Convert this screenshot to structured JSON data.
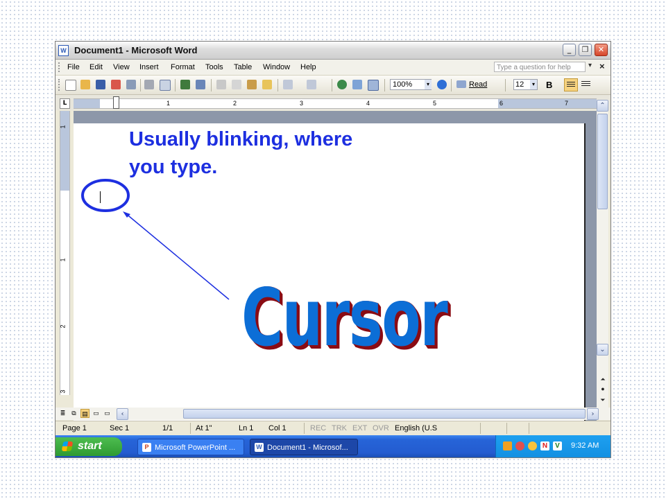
{
  "window": {
    "title": "Document1 - Microsoft Word",
    "doc_icon": "W",
    "minimize_icon": "_",
    "restore_icon": "❐",
    "close_icon": "✕"
  },
  "menu": {
    "items": [
      "File",
      "Edit",
      "View",
      "Insert",
      "Format",
      "Tools",
      "Table",
      "Window",
      "Help"
    ],
    "help_placeholder": "Type a question for help",
    "close_icon": "×",
    "dropdown_icon": "▾"
  },
  "toolbar": {
    "zoom": "100%",
    "read_label": "Read",
    "font_size": "12",
    "bold_label": "B",
    "dropdown_icon": "▾",
    "icons": [
      "new-icon",
      "open-icon",
      "save-icon",
      "permission-icon",
      "print-icon",
      "print-preview-icon",
      "spelling-icon",
      "research-icon",
      "cut-icon",
      "copy-icon",
      "paste-icon",
      "format-painter-icon",
      "undo-icon",
      "redo-icon",
      "hyperlink-icon",
      "tables-borders-icon",
      "insert-table-icon"
    ]
  },
  "ruler": {
    "tab_selector": "L",
    "horizontal_numbers": [
      "1",
      "2",
      "3",
      "4",
      "5",
      "6",
      "7"
    ],
    "vertical_numbers": [
      "1",
      "1",
      "2",
      "3"
    ]
  },
  "scrollbar": {
    "up_icon": "⌃",
    "down_icon": "⌄",
    "prev_page_icon": "⏶",
    "select_browse_icon": "●",
    "next_page_icon": "⏷",
    "left_icon": "‹",
    "right_icon": "›",
    "thumb_grip": "≡",
    "h_thumb_grip": "|||"
  },
  "view_buttons": [
    "≣",
    "⧉",
    "▤",
    "▭"
  ],
  "status": {
    "page": "Page  1",
    "section": "Sec  1",
    "page_of": "1/1",
    "at": "At  1\"",
    "line": "Ln  1",
    "col": "Col  1",
    "rec": "REC",
    "trk": "TRK",
    "ext": "EXT",
    "ovr": "OVR",
    "language": "English (U.S"
  },
  "taskbar": {
    "start": "start",
    "items": [
      {
        "label": "Microsoft PowerPoint ...",
        "icon": "P"
      },
      {
        "label": "Document1 - Microsof...",
        "icon": "W"
      }
    ],
    "tray_icons": [
      "N",
      "V"
    ],
    "clock": "9:32 AM"
  },
  "annotation": {
    "caption": "Usually blinking, where you type.",
    "word": "Cursor",
    "circle_color": "#1d2fe0",
    "arrow_color": "#1d2fe0",
    "word_color": "#0c6ed6",
    "word_shadow_color": "#8a0c14"
  },
  "colors": {
    "titlebar_accent": "#2b59b6",
    "taskbar": "#245cd0",
    "start_green": "#2e9a31",
    "tray_blue": "#1290e2",
    "active_view": "#f6d27f"
  }
}
